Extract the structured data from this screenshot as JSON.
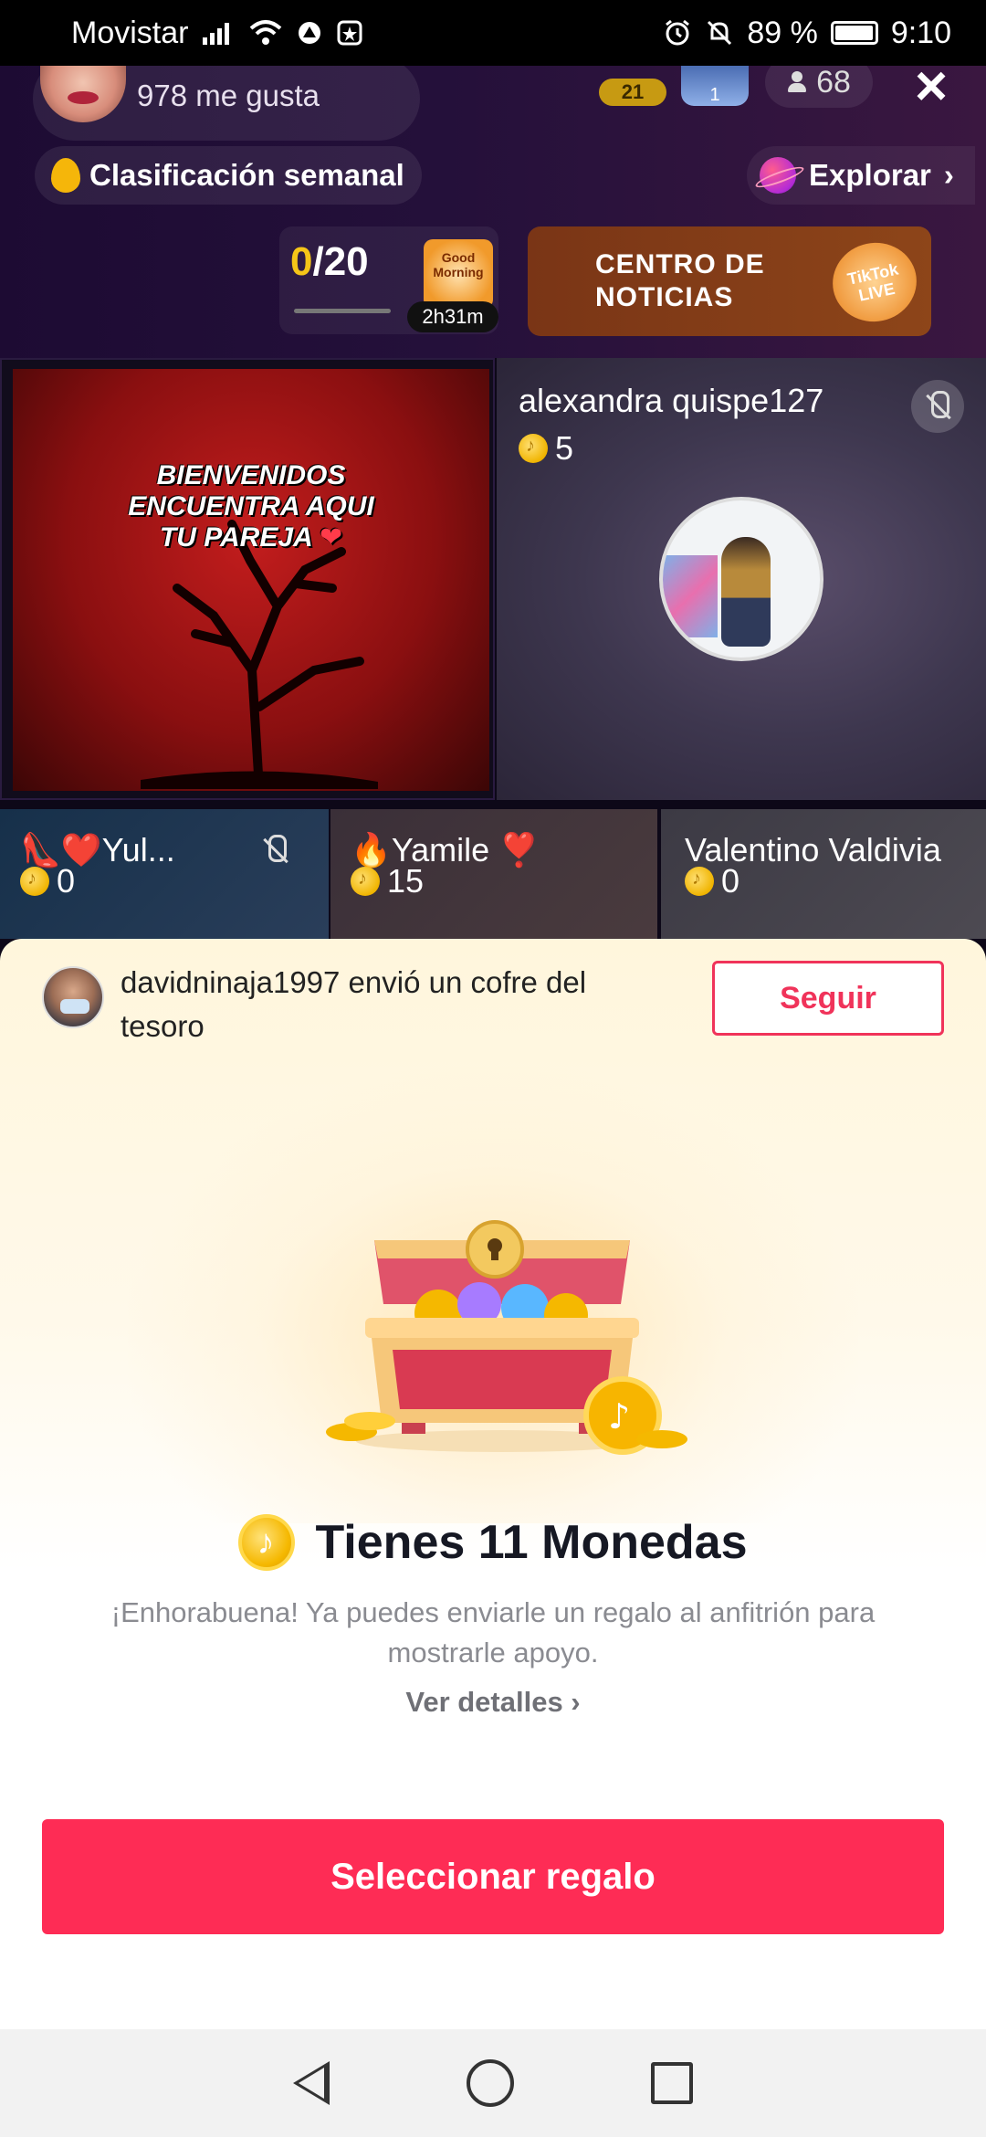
{
  "status_bar": {
    "carrier": "Movistar",
    "battery_text": "89 %",
    "battery_level": 0.89,
    "time": "9:10"
  },
  "live_header": {
    "host_likes": "978 me gusta",
    "rank_badge": "21",
    "user_badge": "1",
    "viewer_count": "68",
    "ranking_label": "Clasificación semanal",
    "explore_label": "Explorar",
    "goal_current": "0",
    "goal_total": "/20",
    "morning_sticker": "Good Morning",
    "timer": "2h31m",
    "news_label": "CENTRO DE NOTICIAS",
    "news_logo": "TikTok LIVE"
  },
  "grid": {
    "main_banner_line1": "BIENVENIDOS",
    "main_banner_line2": "ENCUENTRA AQUI",
    "main_banner_line3": "TU PAREJA",
    "guests": [
      {
        "name": "alexandra quispe127",
        "coins": "5"
      },
      {
        "name": "👠❤️Yul...",
        "coins": "0"
      },
      {
        "name": "🔥Yamile ❣️",
        "coins": "15"
      },
      {
        "name": "Valentino Valdivia",
        "coins": "0"
      }
    ]
  },
  "sheet": {
    "sender_message": "davidninaja1997 envió un cofre del tesoro",
    "follow_label": "Seguir",
    "coins_title": "Tienes 11 Monedas",
    "congrats_text": "¡Enhorabuena! Ya puedes enviarle un regalo al anfitrión para mostrarle apoyo.",
    "details_label": "Ver detalles ›",
    "select_gift_label": "Seleccionar regalo"
  },
  "colors": {
    "accent": "#fe2c55",
    "coin": "#f5b800",
    "sheet_top": "#fff6dc"
  }
}
